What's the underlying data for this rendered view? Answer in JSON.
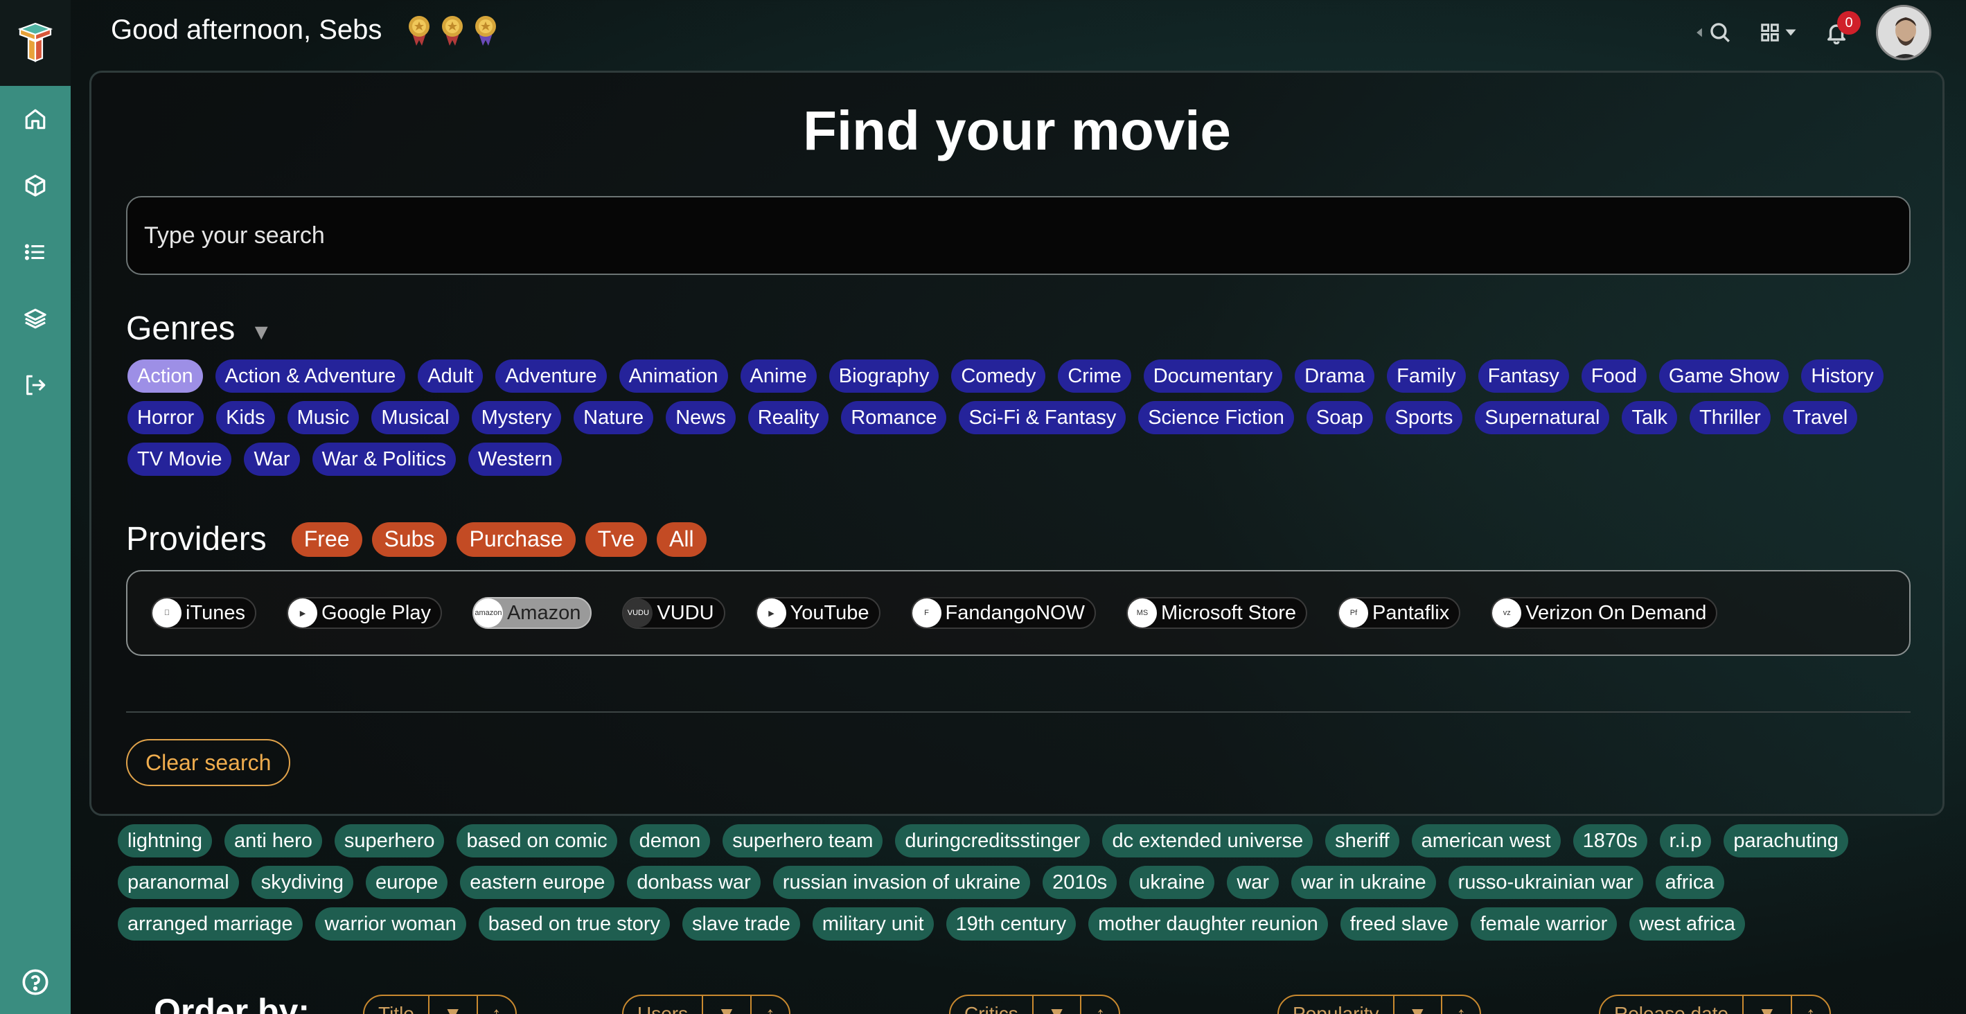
{
  "greeting": "Good afternoon,  Sebs",
  "header": {
    "notifications_count": "0"
  },
  "sidebar": {
    "items": [
      {
        "icon": "home-icon"
      },
      {
        "icon": "box-icon"
      },
      {
        "icon": "list-icon"
      },
      {
        "icon": "layers-icon"
      },
      {
        "icon": "logout-icon"
      }
    ],
    "help_icon": "help-icon"
  },
  "title": "Find your movie",
  "search": {
    "placeholder": "Type your search"
  },
  "genres": {
    "label": "Genres",
    "items": [
      "Action",
      "Action & Adventure",
      "Adult",
      "Adventure",
      "Animation",
      "Anime",
      "Biography",
      "Comedy",
      "Crime",
      "Documentary",
      "Drama",
      "Family",
      "Fantasy",
      "Food",
      "Game Show",
      "History",
      "Horror",
      "Kids",
      "Music",
      "Musical",
      "Mystery",
      "Nature",
      "News",
      "Reality",
      "Romance",
      "Sci-Fi & Fantasy",
      "Science Fiction",
      "Soap",
      "Sports",
      "Supernatural",
      "Talk",
      "Thriller",
      "Travel",
      "TV Movie",
      "War",
      "War & Politics",
      "Western"
    ],
    "selected": "Action"
  },
  "providers": {
    "label": "Providers",
    "filters": [
      "Free",
      "Subs",
      "Purchase",
      "Tve",
      "All"
    ],
    "items": [
      "iTunes",
      "Google Play",
      "Amazon",
      "VUDU",
      "YouTube",
      "FandangoNOW",
      "Microsoft Store",
      "Pantaflix",
      "Verizon On Demand"
    ],
    "active": "Amazon"
  },
  "clear_search": "Clear search",
  "keywords": [
    "lightning",
    "anti hero",
    "superhero",
    "based on comic",
    "demon",
    "superhero team",
    "duringcreditsstinger",
    "dc extended universe",
    "sheriff",
    "american west",
    "1870s",
    "r.i.p",
    "parachuting",
    "paranormal",
    "skydiving",
    "europe",
    "eastern europe",
    "donbass war",
    "russian invasion of ukraine",
    "2010s",
    "ukraine",
    "war",
    "war in ukraine",
    "russo-ukrainian war",
    "africa",
    "arranged marriage",
    "warrior woman",
    "based on true story",
    "slave trade",
    "military unit",
    "19th century",
    "mother daughter reunion",
    "freed slave",
    "female warrior",
    "west africa"
  ],
  "order_by": {
    "label": "Order by:",
    "groups": [
      "Title",
      "Users",
      "Critics",
      "Popularity",
      "Release date"
    ]
  },
  "colors": {
    "sidebar": "#3a8d80",
    "genre_chip": "#25239a",
    "genre_selected": "#9d8fe6",
    "provider_filter": "#c34b24",
    "keyword_chip": "#1f5e50",
    "accent_orange": "#f0ad4e"
  }
}
